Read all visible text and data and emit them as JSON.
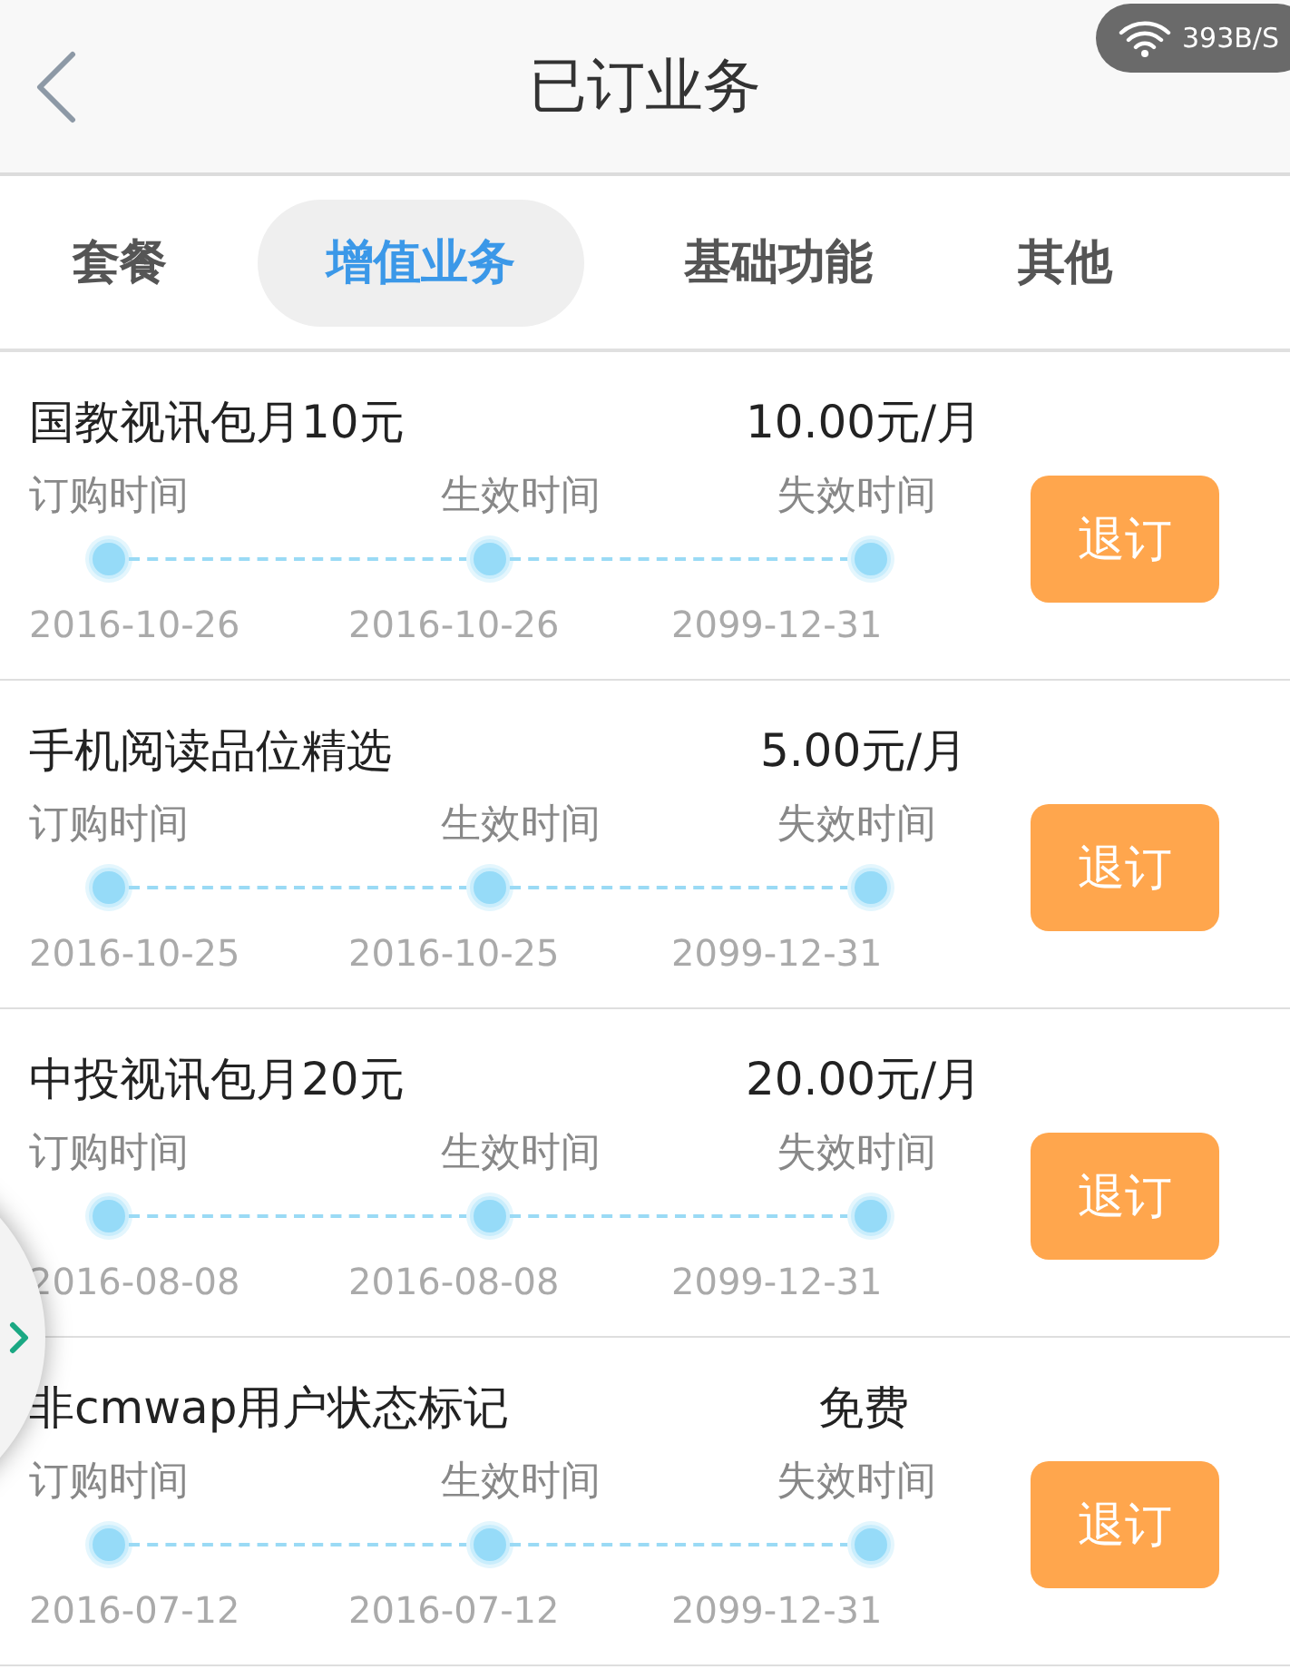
{
  "status_badge": {
    "speed": "393B/S"
  },
  "header": {
    "title": "已订业务"
  },
  "tabs": [
    {
      "label": "套餐",
      "selected": false
    },
    {
      "label": "增值业务",
      "selected": true
    },
    {
      "label": "基础功能",
      "selected": false
    },
    {
      "label": "其他",
      "selected": false
    }
  ],
  "subscriptions": [
    {
      "name": "国教视讯包月10元",
      "price": "10.00元/月",
      "timeline": [
        {
          "label": "订购时间",
          "date": "2016-10-26"
        },
        {
          "label": "生效时间",
          "date": "2016-10-26"
        },
        {
          "label": "失效时间",
          "date": "2099-12-31"
        }
      ],
      "button": "退订"
    },
    {
      "name": "手机阅读品位精选",
      "price": "5.00元/月",
      "timeline": [
        {
          "label": "订购时间",
          "date": "2016-10-25"
        },
        {
          "label": "生效时间",
          "date": "2016-10-25"
        },
        {
          "label": "失效时间",
          "date": "2099-12-31"
        }
      ],
      "button": "退订"
    },
    {
      "name": "中投视讯包月20元",
      "price": "20.00元/月",
      "timeline": [
        {
          "label": "订购时间",
          "date": "2016-08-08"
        },
        {
          "label": "生效时间",
          "date": "2016-08-08"
        },
        {
          "label": "失效时间",
          "date": "2099-12-31"
        }
      ],
      "button": "退订"
    },
    {
      "name": "非cmwap用户状态标记",
      "price": "免费",
      "timeline": [
        {
          "label": "订购时间",
          "date": "2016-07-12"
        },
        {
          "label": "生效时间",
          "date": "2016-07-12"
        },
        {
          "label": "失效时间",
          "date": "2099-12-31"
        }
      ],
      "button": "退订"
    }
  ]
}
